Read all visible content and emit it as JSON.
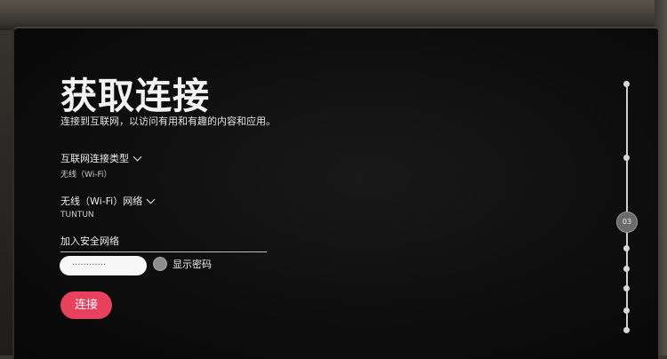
{
  "page": {
    "title": "获取连接",
    "subtitle": "连接到互联网，以访问有用和有趣的内容和应用。"
  },
  "internet_type": {
    "label": "互联网连接类型",
    "value": "无线（Wi-Fi）"
  },
  "wifi_network": {
    "label": "无线（Wi-Fi）网络",
    "value": "TUNTUN"
  },
  "secure_network": {
    "label": "加入安全网络",
    "password_value": "············"
  },
  "show_password": {
    "label": "显示密码",
    "checked": false
  },
  "connect_button": {
    "label": "连接",
    "color": "#e8415e"
  },
  "progress": {
    "current_step": "03",
    "total_steps": 9,
    "current_index": 3
  },
  "icons": [
    "chevron-down-icon",
    "checkbox-icon",
    "step-dot-icon"
  ]
}
